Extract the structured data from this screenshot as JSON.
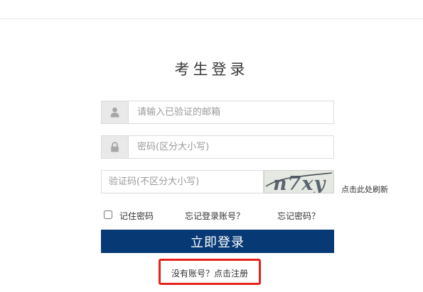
{
  "page": {
    "title": "考生登录"
  },
  "form": {
    "email_placeholder": "请输入已验证的邮箱",
    "password_placeholder": "密码(区分大小写)",
    "captcha_placeholder": "验证码(不区分大小写)",
    "captcha_text": "n7xy",
    "refresh_label": "点击此处刷新",
    "remember_label": "记住密码",
    "remember_checked": false,
    "forgot_account_label": "忘记登录账号？",
    "forgot_password_label": "忘记密码？",
    "login_label": "立即登录",
    "register_label": "没有账号？点击注册"
  },
  "colors": {
    "login_button_bg": "#073a75",
    "highlight_border": "#e8221a",
    "addon_bg": "#e9e9e9"
  },
  "icons": {
    "email_addon": "user-icon",
    "password_addon": "lock-icon"
  }
}
